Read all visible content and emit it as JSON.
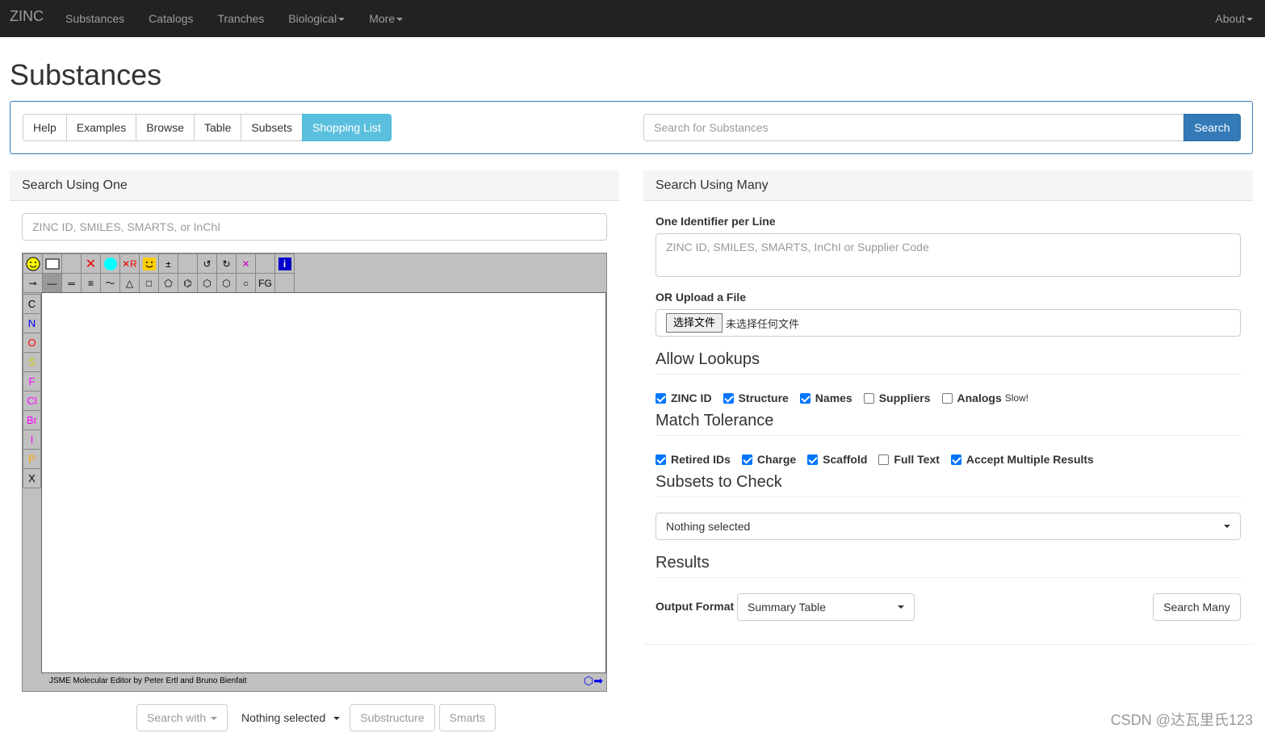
{
  "navbar": {
    "brand": "ZINC",
    "items": [
      "Substances",
      "Catalogs",
      "Tranches",
      "Biological",
      "More"
    ],
    "right": "About"
  },
  "page_title": "Substances",
  "toolbar": {
    "buttons": [
      "Help",
      "Examples",
      "Browse",
      "Table",
      "Subsets",
      "Shopping List"
    ],
    "search_placeholder": "Search for Substances",
    "search_label": "Search"
  },
  "left": {
    "heading": "Search Using One",
    "input_placeholder": "ZINC ID, SMILES, SMARTS, or InChI",
    "jsme": {
      "atoms": [
        "C",
        "N",
        "O",
        "S",
        "F",
        "Cl",
        "Br",
        "I",
        "P",
        "X"
      ],
      "atom_colors": [
        "#000000",
        "#0000ff",
        "#ff0000",
        "#cccc00",
        "#ff00ff",
        "#ff00ff",
        "#ff00ff",
        "#ff00ff",
        "#ffaa00",
        "#000000"
      ],
      "fg_label": "FG",
      "footer": "JSME Molecular Editor by Peter Ertl and Bruno Bienfait"
    },
    "bottom": {
      "search_with": "Search with",
      "nothing_selected": "Nothing selected",
      "substructure": "Substructure",
      "smarts": "Smarts"
    }
  },
  "right": {
    "heading": "Search Using Many",
    "identifier_label": "One Identifier per Line",
    "identifier_placeholder": "ZINC ID, SMILES, SMARTS, InChI or Supplier Code",
    "upload_label": "OR Upload a File",
    "file_button": "选择文件",
    "file_none": "未选择任何文件",
    "lookups_title": "Allow Lookups",
    "lookups": [
      {
        "label": "ZINC ID",
        "checked": true
      },
      {
        "label": "Structure",
        "checked": true
      },
      {
        "label": "Names",
        "checked": true
      },
      {
        "label": "Suppliers",
        "checked": false
      },
      {
        "label": "Analogs",
        "checked": false
      }
    ],
    "slow_note": "Slow!",
    "tolerance_title": "Match Tolerance",
    "tolerance": [
      {
        "label": "Retired IDs",
        "checked": true
      },
      {
        "label": "Charge",
        "checked": true
      },
      {
        "label": "Scaffold",
        "checked": true
      },
      {
        "label": "Full Text",
        "checked": false
      },
      {
        "label": "Accept Multiple Results",
        "checked": true
      }
    ],
    "subsets_title": "Subsets to Check",
    "subsets_value": "Nothing selected",
    "results_title": "Results",
    "output_label": "Output Format",
    "output_value": "Summary Table",
    "search_many": "Search Many"
  },
  "watermark": "CSDN @达瓦里氏123"
}
